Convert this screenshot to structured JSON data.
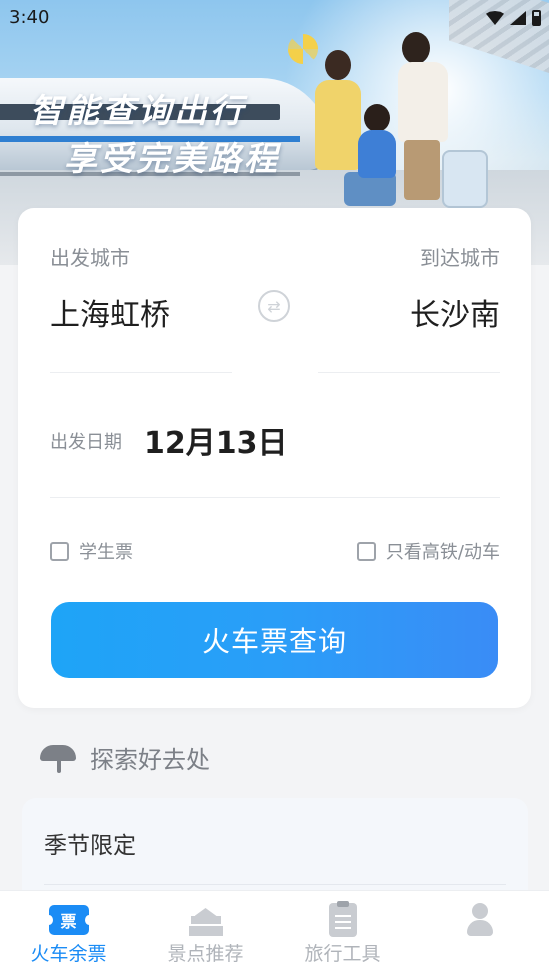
{
  "status_bar": {
    "time": "3:40"
  },
  "banner": {
    "slogan_line1": "智能查询出行",
    "slogan_line2": "享受完美路程"
  },
  "search": {
    "departure_label": "出发城市",
    "arrival_label": "到达城市",
    "departure_city": "上海虹桥",
    "arrival_city": "长沙南",
    "date_label": "出发日期",
    "date_value": "12月13日",
    "student_ticket_label": "学生票",
    "highspeed_only_label": "只看高铁/动车",
    "search_button_label": "火车票查询"
  },
  "explore": {
    "title": "探索好去处"
  },
  "season": {
    "title": "季节限定"
  },
  "tabs": [
    {
      "label": "火车余票",
      "icon": "ticket-icon",
      "active": true
    },
    {
      "label": "景点推荐",
      "icon": "pagoda-icon",
      "active": false
    },
    {
      "label": "旅行工具",
      "icon": "clipboard-icon",
      "active": false
    },
    {
      "label": "",
      "icon": "profile-icon",
      "active": false
    }
  ],
  "colors": {
    "accent": "#1b8cf5",
    "button_start": "#1ea4f7",
    "button_end": "#3a8cf6",
    "background": "#f3f4f6"
  }
}
